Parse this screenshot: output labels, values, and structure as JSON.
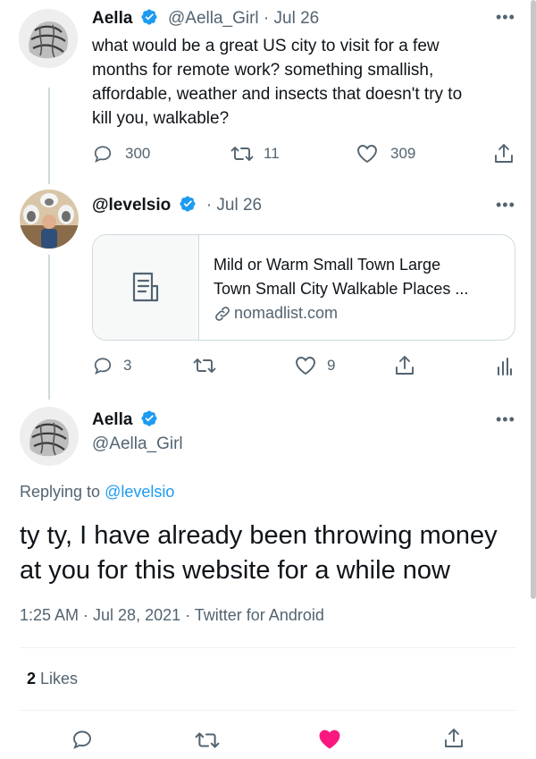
{
  "tweet1": {
    "name": "Aella",
    "handle_date": "@Aella_Girl · Jul 26",
    "text_lines": [
      "what would be a great US city to visit for a few",
      "months for remote work? something smallish,",
      "affordable, weather and insects that doesn't try to",
      "kill you, walkable?"
    ],
    "replies": "300",
    "retweets": "11",
    "likes": "309"
  },
  "tweet2": {
    "handle": "@levelsio",
    "date": "· Jul 26",
    "card": {
      "title_lines": [
        "Mild or Warm Small Town Large",
        "Town Small City Walkable Places ..."
      ],
      "domain": "nomadlist.com"
    },
    "replies": "3",
    "likes": "9"
  },
  "main_tweet": {
    "name": "Aella",
    "handle": "@Aella_Girl",
    "replying_prefix": "Replying to ",
    "replying_to": "@levelsio",
    "text_lines": [
      "ty ty, I have already been throwing money",
      "at you for this website for a while now"
    ],
    "timestamp": "1:25 AM · Jul 28, 2021 · Twitter for Android",
    "likes_count": "2",
    "likes_label": "Likes"
  },
  "colors": {
    "verified": "#1d9bf0",
    "link": "#1d9bf0",
    "like_active": "#f91880",
    "muted": "#536471"
  },
  "icons": {
    "reply": "reply-icon",
    "retweet": "retweet-icon",
    "like": "heart-icon",
    "share": "share-icon",
    "analytics": "analytics-icon",
    "more": "more-icon"
  }
}
